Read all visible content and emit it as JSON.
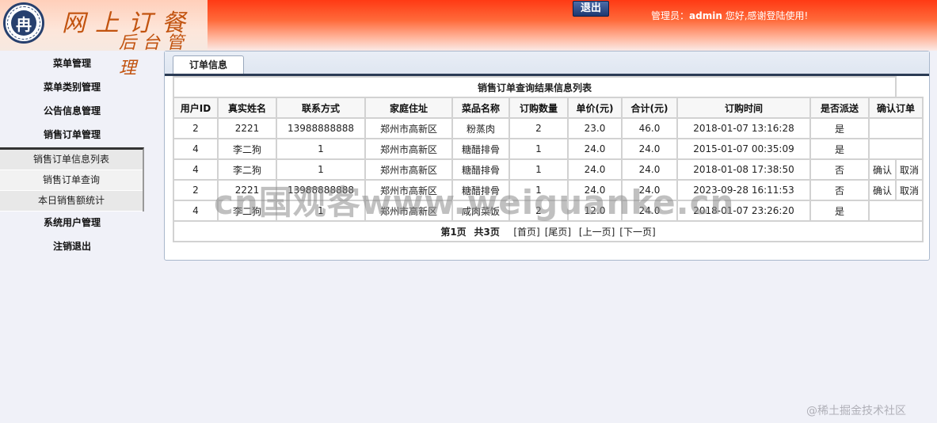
{
  "header": {
    "title_line1": "网上订餐",
    "title_line2": "后台管理",
    "seal_glyph": "冉",
    "logout_label": "退出",
    "greeting_prefix": "管理员：",
    "admin_name": "admin",
    "greeting_suffix": " 您好,感谢登陆使用!"
  },
  "sidebar": {
    "items": [
      {
        "label": "菜单管理"
      },
      {
        "label": "菜单类别管理"
      },
      {
        "label": "公告信息管理"
      },
      {
        "label": "销售订单管理"
      }
    ],
    "submenu": [
      {
        "label": "销售订单信息列表"
      },
      {
        "label": "销售订单查询"
      },
      {
        "label": "本日销售额统计"
      }
    ],
    "items_after": [
      {
        "label": "系统用户管理"
      },
      {
        "label": "注销退出"
      }
    ]
  },
  "main": {
    "tab_label": "订单信息",
    "table_caption": "销售订单查询结果信息列表",
    "columns": [
      "用户ID",
      "真实姓名",
      "联系方式",
      "家庭住址",
      "菜品名称",
      "订购数量",
      "单价(元)",
      "合计(元)",
      "订购时间",
      "是否派送",
      "确认订单"
    ],
    "rows": [
      {
        "uid": "2",
        "name": "2221",
        "phone": "13988888888",
        "addr": "郑州市高新区",
        "dish": "粉蒸肉",
        "qty": "2",
        "price": "23.0",
        "total": "46.0",
        "time": "2018-01-07 13:16:28",
        "sent": "是",
        "confirm": "",
        "cancel": ""
      },
      {
        "uid": "4",
        "name": "李二狗",
        "phone": "1",
        "addr": "郑州市高新区",
        "dish": "糖醋排骨",
        "qty": "1",
        "price": "24.0",
        "total": "24.0",
        "time": "2015-01-07 00:35:09",
        "sent": "是",
        "confirm": "",
        "cancel": ""
      },
      {
        "uid": "4",
        "name": "李二狗",
        "phone": "1",
        "addr": "郑州市高新区",
        "dish": "糖醋排骨",
        "qty": "1",
        "price": "24.0",
        "total": "24.0",
        "time": "2018-01-08 17:38:50",
        "sent": "否",
        "confirm": "确认",
        "cancel": "取消"
      },
      {
        "uid": "2",
        "name": "2221",
        "phone": "13988888888",
        "addr": "郑州市高新区",
        "dish": "糖醋排骨",
        "qty": "1",
        "price": "24.0",
        "total": "24.0",
        "time": "2023-09-28 16:11:53",
        "sent": "否",
        "confirm": "确认",
        "cancel": "取消"
      },
      {
        "uid": "4",
        "name": "李二狗",
        "phone": "1",
        "addr": "郑州市高新区",
        "dish": "咸肉菜饭",
        "qty": "2",
        "price": "12.0",
        "total": "24.0",
        "time": "2018-01-07 23:26:20",
        "sent": "是",
        "confirm": "",
        "cancel": ""
      }
    ],
    "pager": {
      "page_info": "第1页",
      "total_info": "共3页",
      "first": "[首页]",
      "last": "[尾页]",
      "prev": "[上一页]",
      "next": "[下一页]"
    }
  },
  "watermark": "cn国观客www.weiguanke.cn",
  "corner_watermark": "@稀土掘金技术社区"
}
